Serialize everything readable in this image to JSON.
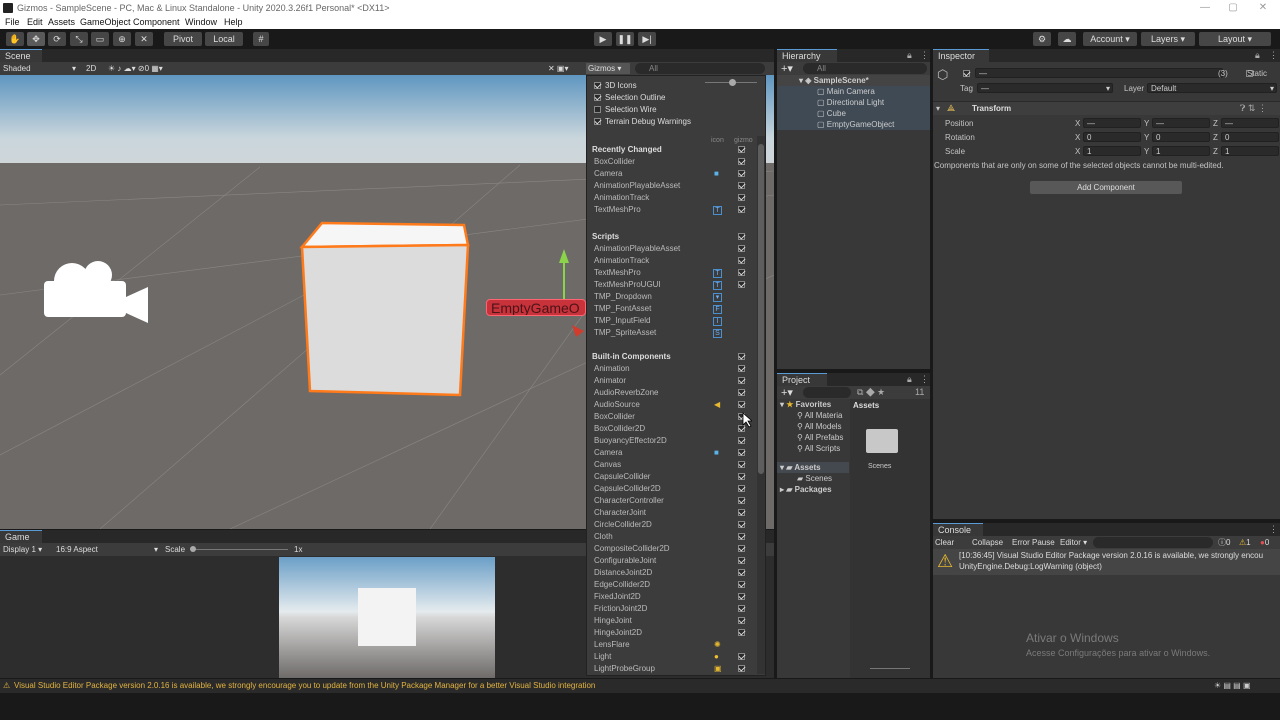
{
  "window": {
    "title": "Gizmos - SampleScene - PC, Mac & Linux Standalone - Unity 2020.3.26f1 Personal* <DX11>"
  },
  "menu": [
    "File",
    "Edit",
    "Assets",
    "GameObject",
    "Component",
    "Window",
    "Help"
  ],
  "toolbar": {
    "pivot": "Pivot",
    "local": "Local",
    "account": "Account",
    "layers": "Layers",
    "layout": "Layout"
  },
  "scene": {
    "tab": "Scene",
    "shading": "Shaded",
    "mode2d": "2D",
    "gizmo_count": "0",
    "gizmos_label": "Gizmos",
    "search_placeholder": "All",
    "object_label": "EmptyGameO"
  },
  "gizmos_menu": {
    "toggles": [
      {
        "label": "3D Icons",
        "on": true
      },
      {
        "label": "Selection Outline",
        "on": true
      },
      {
        "label": "Selection Wire",
        "on": false
      },
      {
        "label": "Terrain Debug Warnings",
        "on": true
      }
    ],
    "col_icon": "icon",
    "col_gizmo": "gizmo",
    "sections": [
      {
        "title": "Recently Changed",
        "items": [
          {
            "name": "BoxCollider",
            "icon": "",
            "gizmo": true
          },
          {
            "name": "Camera",
            "icon": "cam",
            "gizmo": true
          },
          {
            "name": "AnimationPlayableAsset",
            "icon": "",
            "gizmo": true
          },
          {
            "name": "AnimationTrack",
            "icon": "",
            "gizmo": true
          },
          {
            "name": "TextMeshPro",
            "icon": "T",
            "gizmo": true
          }
        ]
      },
      {
        "title": "Scripts",
        "items": [
          {
            "name": "AnimationPlayableAsset",
            "icon": "",
            "gizmo": true
          },
          {
            "name": "AnimationTrack",
            "icon": "",
            "gizmo": true
          },
          {
            "name": "TextMeshPro",
            "icon": "T",
            "gizmo": true
          },
          {
            "name": "TextMeshProUGUI",
            "icon": "T",
            "gizmo": true
          },
          {
            "name": "TMP_Dropdown",
            "icon": "▾",
            "gizmo": false
          },
          {
            "name": "TMP_FontAsset",
            "icon": "F",
            "gizmo": false
          },
          {
            "name": "TMP_InputField",
            "icon": "I",
            "gizmo": false
          },
          {
            "name": "TMP_SpriteAsset",
            "icon": "S",
            "gizmo": false
          }
        ]
      },
      {
        "title": "Built-in Components",
        "items": [
          {
            "name": "Animation",
            "icon": "",
            "gizmo": true
          },
          {
            "name": "Animator",
            "icon": "",
            "gizmo": true
          },
          {
            "name": "AudioReverbZone",
            "icon": "",
            "gizmo": true
          },
          {
            "name": "AudioSource",
            "icon": "spk",
            "gizmo": true
          },
          {
            "name": "BoxCollider",
            "icon": "",
            "gizmo": true
          },
          {
            "name": "BoxCollider2D",
            "icon": "",
            "gizmo": true
          },
          {
            "name": "BuoyancyEffector2D",
            "icon": "",
            "gizmo": true
          },
          {
            "name": "Camera",
            "icon": "cam",
            "gizmo": true
          },
          {
            "name": "Canvas",
            "icon": "",
            "gizmo": true
          },
          {
            "name": "CapsuleCollider",
            "icon": "",
            "gizmo": true
          },
          {
            "name": "CapsuleCollider2D",
            "icon": "",
            "gizmo": true
          },
          {
            "name": "CharacterController",
            "icon": "",
            "gizmo": true
          },
          {
            "name": "CharacterJoint",
            "icon": "",
            "gizmo": true
          },
          {
            "name": "CircleCollider2D",
            "icon": "",
            "gizmo": true
          },
          {
            "name": "Cloth",
            "icon": "",
            "gizmo": true
          },
          {
            "name": "CompositeCollider2D",
            "icon": "",
            "gizmo": true
          },
          {
            "name": "ConfigurableJoint",
            "icon": "",
            "gizmo": true
          },
          {
            "name": "DistanceJoint2D",
            "icon": "",
            "gizmo": true
          },
          {
            "name": "EdgeCollider2D",
            "icon": "",
            "gizmo": true
          },
          {
            "name": "FixedJoint2D",
            "icon": "",
            "gizmo": true
          },
          {
            "name": "FrictionJoint2D",
            "icon": "",
            "gizmo": true
          },
          {
            "name": "HingeJoint",
            "icon": "",
            "gizmo": true
          },
          {
            "name": "HingeJoint2D",
            "icon": "",
            "gizmo": true
          },
          {
            "name": "LensFlare",
            "icon": "sun",
            "gizmo": false
          },
          {
            "name": "Light",
            "icon": "bulb",
            "gizmo": true
          },
          {
            "name": "LightProbeGroup",
            "icon": "probe",
            "gizmo": true
          }
        ]
      }
    ]
  },
  "game": {
    "tab": "Game",
    "display": "Display 1",
    "aspect": "16:9 Aspect",
    "scale_label": "Scale",
    "scale_value": "1x"
  },
  "hierarchy": {
    "tab": "Hierarchy",
    "search": "All",
    "scene": "SampleScene*",
    "items": [
      "Main Camera",
      "Directional Light",
      "Cube",
      "EmptyGameObject"
    ]
  },
  "project": {
    "tab": "Project",
    "favorites": "Favorites",
    "fav_items": [
      "All Materia",
      "All Models",
      "All Prefabs",
      "All Scripts"
    ],
    "assets": "Assets",
    "asset_children": [
      "Scenes"
    ],
    "packages": "Packages",
    "breadcrumb": "Assets",
    "folder": "Scenes",
    "count": "11"
  },
  "inspector": {
    "tab": "Inspector",
    "name_value": "—",
    "count": "(3)",
    "static": "Static",
    "tag_label": "Tag",
    "tag_value": "—",
    "layer_label": "Layer",
    "layer_value": "Default",
    "component": "Transform",
    "rows": [
      {
        "label": "Position",
        "x": "—",
        "y": "—",
        "z": "—"
      },
      {
        "label": "Rotation",
        "x": "0",
        "y": "0",
        "z": "0"
      },
      {
        "label": "Scale",
        "x": "1",
        "y": "1",
        "z": "1"
      }
    ],
    "notice": "Components that are only on some of the selected objects cannot be multi-edited.",
    "add_component": "Add Component"
  },
  "console": {
    "tab": "Console",
    "clear": "Clear",
    "collapse": "Collapse",
    "error_pause": "Error Pause",
    "editor": "Editor",
    "info": "0",
    "warn": "1",
    "err": "0",
    "message1": "[10:36:45] Visual Studio Editor Package version 2.0.16 is available, we strongly encou",
    "message2": "UnityEngine.Debug:LogWarning (object)"
  },
  "watermark": {
    "line1": "Ativar o Windows",
    "line2": "Acesse Configurações para ativar o Windows."
  },
  "status": "Visual Studio Editor Package version 2.0.16 is available, we strongly encourage you to update from the Unity Package Manager for a better Visual Studio integration"
}
